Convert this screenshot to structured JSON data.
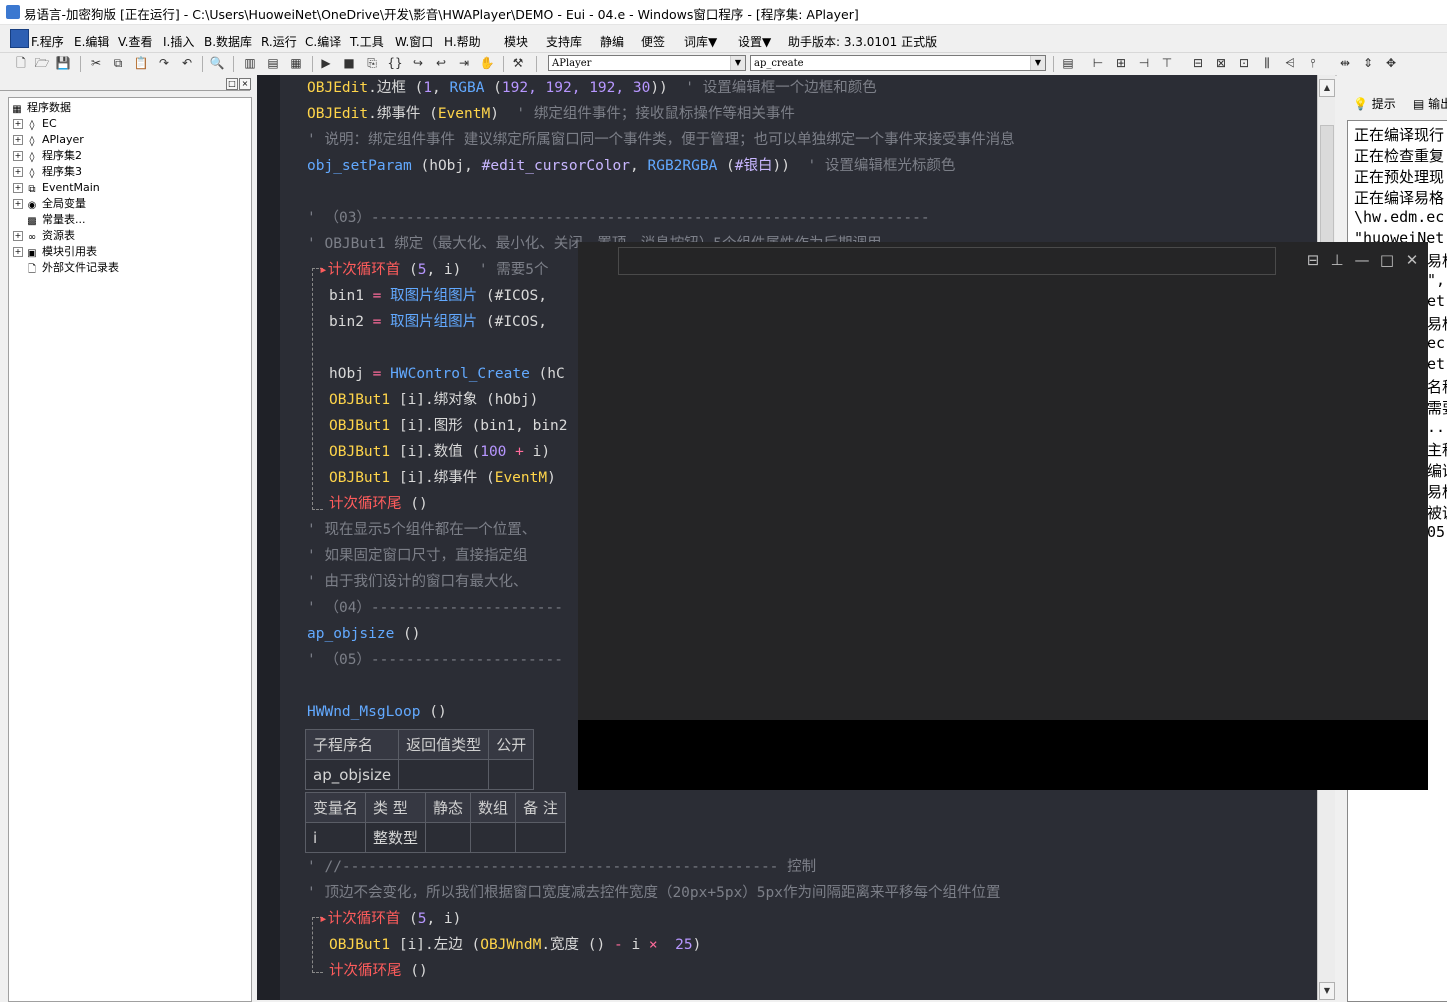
{
  "title": {
    "text": "易语言-加密狗版 [正在运行] - C:\\Users\\HuoweiNet\\OneDrive\\开发\\影音\\HWAPlayer\\DEMO - Eui - 04.e - Windows窗口程序 - [程序集: APlayer]"
  },
  "menu": {
    "items": [
      "F.程序",
      "E.编辑",
      "V.查看",
      "I.插入",
      "B.数据库",
      "R.运行",
      "C.编译",
      "T.工具",
      "W.窗口",
      "H.帮助",
      "模块",
      "支持库",
      "静编",
      "便签",
      "词库▼",
      "设置▼"
    ],
    "helper_version": "助手版本: 3.3.0101 正式版"
  },
  "toolbar": {
    "combo_class": "APlayer",
    "combo_method": "ap_create"
  },
  "tree": {
    "root": "程序数据",
    "items": [
      "EC",
      "APlayer",
      "程序集2",
      "程序集3",
      "EventMain",
      "全局变量",
      "常量表...",
      "资源表",
      "模块引用表",
      "外部文件记录表"
    ]
  },
  "code": {
    "l1_obj": "OBJEdit",
    "l1_m": ".边框 (",
    "l1_a1": "1",
    "l1_f": "RGBA",
    "l1_p": " (",
    "l1_n": "192, 192, 192, 30",
    "l1_e": "))",
    "l1_c": "  ' 设置编辑框一个边框和颜色",
    "l2_obj": "OBJEdit",
    "l2_m": ".绑事件 (",
    "l2_a": "EventM",
    "l2_e": ")",
    "l2_c": "  ' 绑定组件事件；接收鼠标操作等相关事件",
    "l3": "' 说明：绑定组件事件 建议绑定所属窗口同一个事件类，便于管理；也可以单独绑定一个事件来接受事件消息",
    "l4_f": "obj_setParam",
    "l4_a": " (hObj, ",
    "l4_c": "#edit_cursorColor",
    "l4_s": ", ",
    "l4_f2": "RGB2RGBA",
    "l4_p": " (",
    "l4_c2": "#银白",
    "l4_e": "))",
    "l4_cm": "  ' 设置编辑框光标颜色",
    "l5": "' （03）----------------------------------------------------------------",
    "l6": "' OBJBut1 绑定（最大化、最小化、关闭、置顶、消息按钮）5个组件属性作为后期调用",
    "l7_kw": "计次循环首",
    "l7_a": " (",
    "l7_n": "5",
    "l7_b": ", i)",
    "l7_c": "  ' 需要5个",
    "l8_v": "bin1",
    "l8_eq": " = ",
    "l8_f": "取图片组图片",
    "l8_a": " (#ICOS,",
    "l9_v": "bin2",
    "l9_eq": " = ",
    "l9_f": "取图片组图片",
    "l9_a": " (#ICOS,",
    "l10_v": "hObj",
    "l10_eq": " = ",
    "l10_f": "HWControl_Create",
    "l10_a": " (hC",
    "l11_o": "OBJBut1",
    "l11_a": " [i].绑对象 (hObj)",
    "l12_o": "OBJBut1",
    "l12_a": " [i].图形 (bin1, bin2",
    "l13_o": "OBJBut1",
    "l13_a": " [i].数值 (",
    "l13_n": "100",
    "l13_op": " + ",
    "l13_b": "i)",
    "l14_o": "OBJBut1",
    "l14_a": " [i].绑事件 (",
    "l14_e": "EventM",
    "l14_c": ")",
    "l15_kw": "计次循环尾",
    "l15_a": " ()",
    "l16": "' 现在显示5个组件都在一个位置、",
    "l17": "' 如果固定窗口尺寸，直接指定组",
    "l18": "' 由于我们设计的窗口有最大化、",
    "l19": "' （04）----------------------",
    "l20_f": "ap_objsize",
    "l20_a": " ()",
    "l21": "' （05）----------------------",
    "l22_f": "HWWnd_MsgLoop",
    "l22_a": " ()",
    "sub_headers": [
      "子程序名",
      "返回值类型",
      "公开"
    ],
    "sub_row": [
      "ap_objsize",
      "",
      ""
    ],
    "var_headers": [
      "变量名",
      "类 型",
      "静态",
      "数组",
      "备 注"
    ],
    "var_row": [
      "i",
      "整数型",
      "",
      "",
      ""
    ],
    "l23": "' //-------------------------------------------------- 控制",
    "l24": "' 顶边不会变化，所以我们根据窗口宽度减去控件宽度（20px+5px）5px作为间隔距离来平移每个组件位置",
    "l25_kw": "计次循环首",
    "l25_a": " (",
    "l25_n": "5",
    "l25_b": ", i)",
    "l26_o": "OBJBut1",
    "l26_a": " [i].左边 (",
    "l26_w": "OBJWndM",
    "l26_b": ".宽度 () ",
    "l26_op1": "-",
    "l26_i": " i ",
    "l26_op2": "×",
    "l26_n": "  25",
    "l26_e": ")",
    "l27_kw": "计次循环尾",
    "l27_a": " ()"
  },
  "right": {
    "tab1": "提示",
    "tab2": "输出",
    "lines": [
      "正在编译现行",
      "正在检查重复",
      "正在预处理现",
      "正在编译易格",
      "\\hw.edm.ec",
      "\"huoweiNet",
      "易格",
      "\",",
      "et\"",
      "易格",
      "ec\"",
      "et\"",
      "名称",
      "需要",
      "...",
      "主程",
      "编译",
      "易格",
      "被调",
      "05"
    ]
  }
}
